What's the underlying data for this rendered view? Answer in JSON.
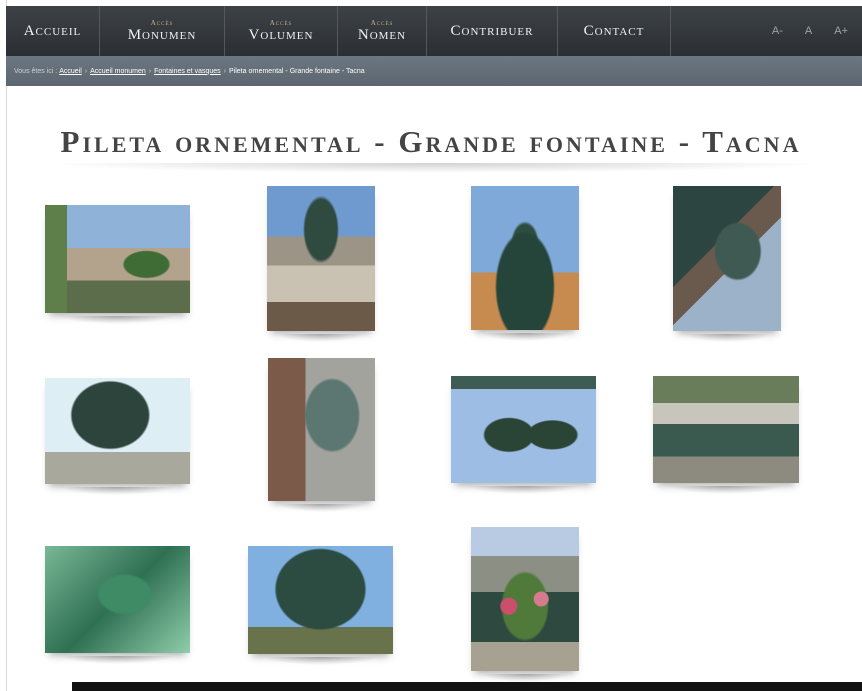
{
  "nav": {
    "items": [
      {
        "type": "single",
        "label": "Accueil"
      },
      {
        "type": "double",
        "small": "Accès",
        "big": "Monumen"
      },
      {
        "type": "double",
        "small": "Accès",
        "big": "Volumen"
      },
      {
        "type": "double",
        "small": "Accès",
        "big": "Nomen"
      },
      {
        "type": "single",
        "label": "Contribuer"
      },
      {
        "type": "single",
        "label": "Contact"
      }
    ],
    "font_controls": {
      "decrease": "A-",
      "normal": "A",
      "increase": "A+"
    }
  },
  "breadcrumb": {
    "prefix": "Vous êtes ici :",
    "links": [
      "Accueil",
      "Accueil monumen",
      "Fontaines et vasques"
    ],
    "current": "Pileta ornemental - Grande fontaine - Tacna"
  },
  "page": {
    "title": "Pileta ornemental - Grande fontaine - Tacna"
  },
  "gallery": {
    "photos": [
      {
        "subject": "fountain-plaza-cathedral"
      },
      {
        "subject": "fountain-plaza-view"
      },
      {
        "subject": "fountain-basin-sky"
      },
      {
        "subject": "statue-child-detail"
      },
      {
        "subject": "basin-underside"
      },
      {
        "subject": "statue-woman-detail"
      },
      {
        "subject": "statues-cherubs"
      },
      {
        "subject": "fountain-basin-rail"
      },
      {
        "subject": "ornament-relief"
      },
      {
        "subject": "upper-basin-sky"
      },
      {
        "subject": "flower-urn"
      }
    ]
  },
  "colors": {
    "nav_bg": "#34393d",
    "breadcrumb_bg": "#646f79",
    "title_text": "#444444"
  }
}
